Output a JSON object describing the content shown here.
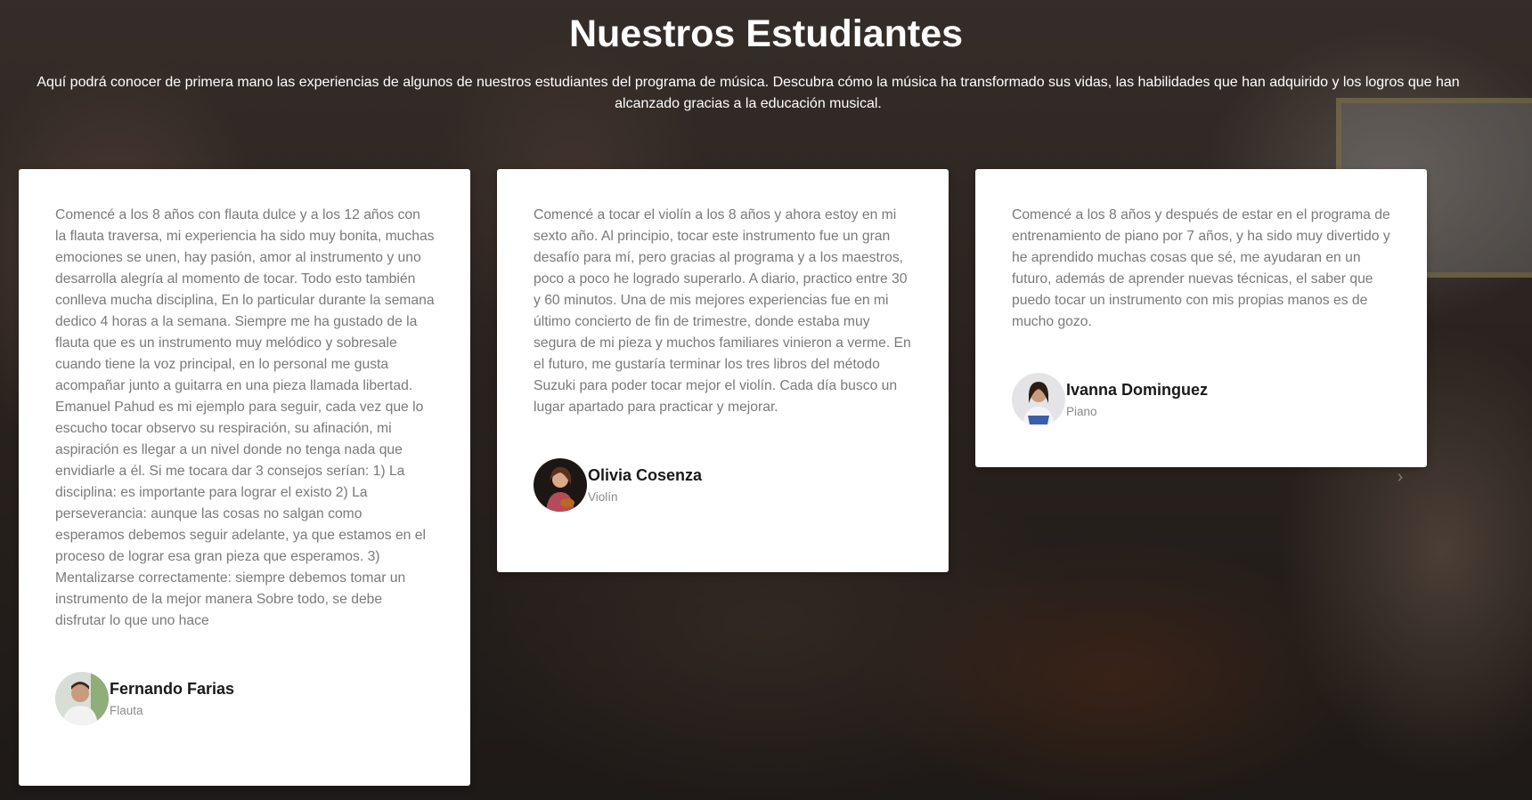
{
  "section": {
    "title": "Nuestros Estudiantes",
    "intro": "Aquí podrá conocer de primera mano las experiencias de algunos de nuestros estudiantes del programa de música. Descubra cómo la música ha transformado sus vidas, las habilidades que han adquirido y los logros que han alcanzado gracias a la educación musical."
  },
  "carousel": {
    "prev_icon": "chevron-left-icon",
    "next_icon": "chevron-right-icon",
    "prev_glyph": "‹",
    "next_glyph": "›"
  },
  "testimonials": [
    {
      "text": "Comencé a los 8 años con flauta dulce y a los 12 años con la flauta traversa, mi experiencia ha sido muy bonita, muchas emociones se unen, hay pasión, amor al instrumento y uno desarrolla alegría al momento de tocar. Todo esto también conlleva mucha disciplina, En lo particular durante la semana dedico 4 horas a la semana. Siempre me ha gustado de la flauta que es un instrumento muy melódico y sobresale cuando tiene la voz principal, en lo personal me gusta acompañar junto a guitarra en una pieza llamada libertad. Emanuel Pahud es mi ejemplo para seguir, cada vez que lo escucho tocar observo su respiración, su afinación, mi aspiración es llegar a un nivel donde no tenga nada que envidiarle a él. Si me tocara dar 3 consejos serían: 1) La disciplina: es importante para lograr el existo 2) La perseverancia: aunque las cosas no salgan como esperamos debemos seguir adelante, ya que estamos en el proceso de lograr esa gran pieza que esperamos. 3) Mentalizarse correctamente: siempre debemos tomar un instrumento de la mejor manera Sobre todo, se debe disfrutar lo que uno hace",
      "name": "Fernando Farias",
      "role": "Flauta"
    },
    {
      "text": "Comencé a tocar el violín a los 8 años y ahora estoy en mi sexto año. Al principio, tocar este instrumento fue un gran desafío para mí, pero gracias al programa y a los maestros, poco a poco he logrado superarlo. A diario, practico entre 30 y 60 minutos. Una de mis mejores experiencias fue en mi último concierto de fin de trimestre, donde estaba muy segura de mi pieza y muchos familiares vinieron a verme. En el futuro, me gustaría terminar los tres libros del método Suzuki para poder tocar mejor el violín. Cada día busco un lugar apartado para practicar y mejorar.",
      "name": "Olivia Cosenza",
      "role": "Violín"
    },
    {
      "text": "Comencé a los 8 años y después de estar en el programa de entrenamiento de piano por 7 años, y ha sido muy divertido y he aprendido muchas cosas que sé, me ayudaran en un futuro, además de aprender nuevas técnicas, el saber que puedo tocar un instrumento con mis propias manos es de mucho gozo.",
      "name": "Ivanna Dominguez",
      "role": "Piano"
    }
  ]
}
